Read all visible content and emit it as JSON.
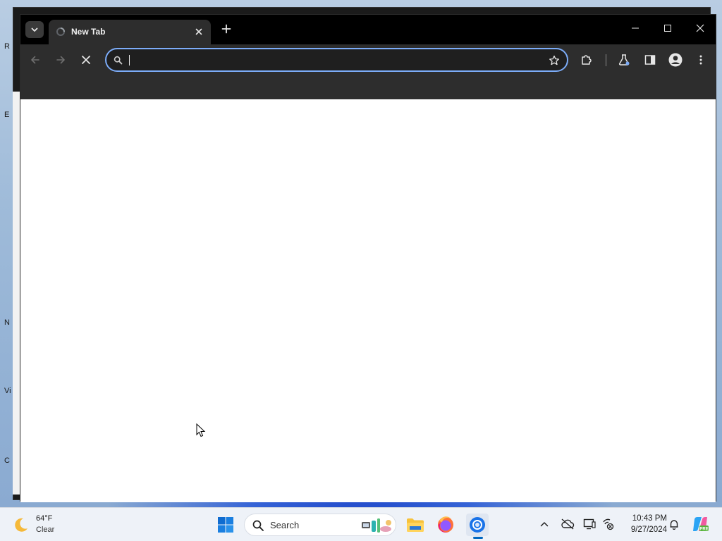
{
  "desktop": {
    "icon_letters": [
      "R",
      "E",
      "N",
      "Vi",
      "C"
    ]
  },
  "browser": {
    "tab": {
      "title": "New Tab"
    },
    "omnibox": {
      "value": "",
      "placeholder": ""
    },
    "state": "loading"
  },
  "taskbar": {
    "weather": {
      "temperature": "64°F",
      "condition": "Clear"
    },
    "search": {
      "label": "Search"
    },
    "clock": {
      "time": "10:43 PM",
      "date": "9/27/2024"
    },
    "apps": [
      "file-explorer",
      "firefox",
      "chrome"
    ]
  },
  "colors": {
    "omnibox_focus": "#7cacf8",
    "toolbar_bg": "#2d2d2d",
    "titlebar_bg": "#000000",
    "taskbar_bg": "#eef2f8",
    "windows_accent": "#0067c0"
  }
}
